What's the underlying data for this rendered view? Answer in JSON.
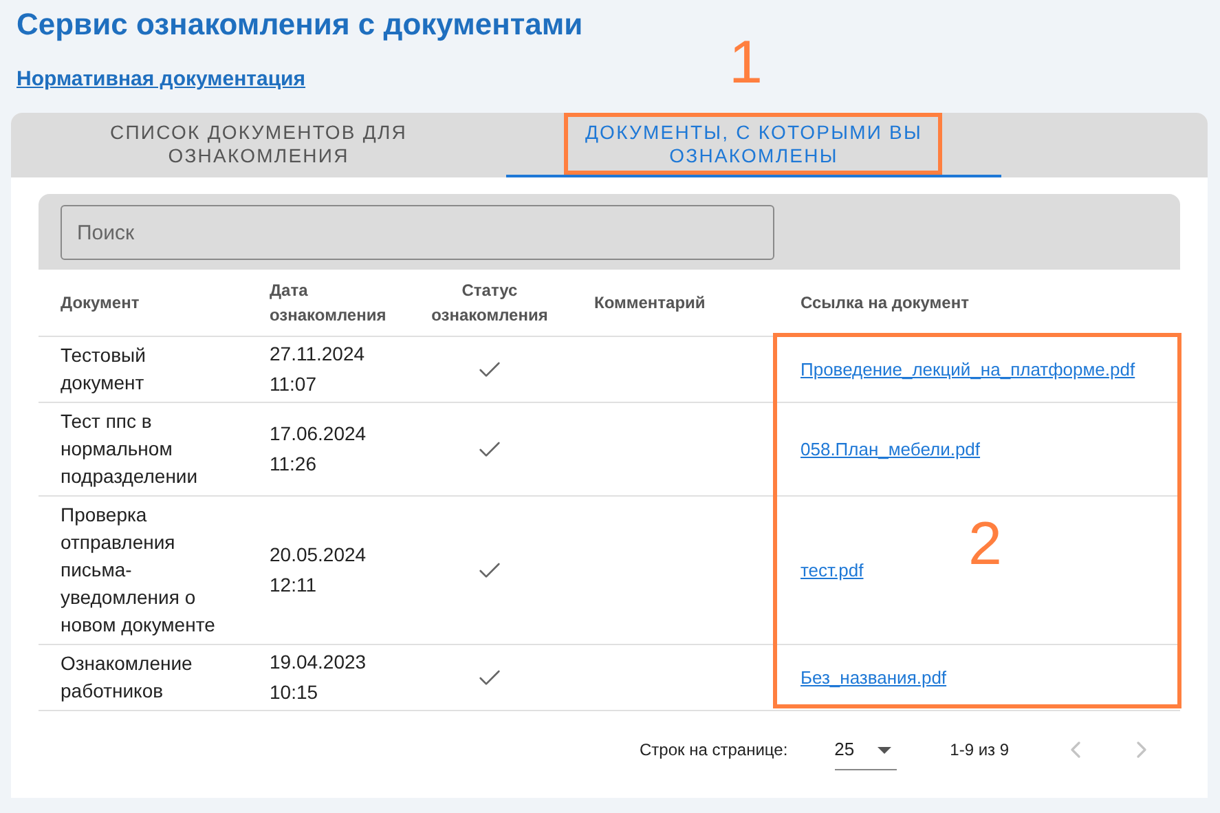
{
  "title": "Сервис ознакомления с документами",
  "link": "Нормативная документация",
  "tabs": [
    {
      "label": "СПИСОК ДОКУМЕНТОВ ДЛЯ ОЗНАКОМЛЕНИЯ",
      "selected": false
    },
    {
      "label": "ДОКУМЕНТЫ, С КОТОРЫМИ ВЫ ОЗНАКОМЛЕНЫ",
      "selected": true
    }
  ],
  "search": {
    "placeholder": "Поиск"
  },
  "table": {
    "columns": [
      "Документ",
      "Дата ознакомления",
      "Статус ознакомления",
      "Комментарий",
      "Ссылка на документ"
    ],
    "rows": [
      {
        "document": "Тестовый документ",
        "date": "27.11.2024 11:07",
        "acknowledged": true,
        "link": "Проведение_лекций_на_платформе.pdf"
      },
      {
        "document": "Тест ппс в нормальном подразделении",
        "date": "17.06.2024 11:26",
        "acknowledged": true,
        "link": "058.План_мебели.pdf"
      },
      {
        "document": "Проверка отправления письма-уведомления о новом документе",
        "date": "20.05.2024 12:11",
        "acknowledged": true,
        "link": "тест.pdf"
      },
      {
        "document": "Ознакомление работников",
        "date": "19.04.2023 10:15",
        "acknowledged": true,
        "link": "Без_названия.pdf"
      }
    ]
  },
  "pagination": {
    "rows_per_page_label": "Строк на странице:",
    "rows_per_page": "25",
    "range": "1-9 из 9",
    "prev_disabled": true,
    "next_disabled": true
  },
  "annotations": [
    {
      "label": "1"
    },
    {
      "label": "2"
    }
  ]
}
